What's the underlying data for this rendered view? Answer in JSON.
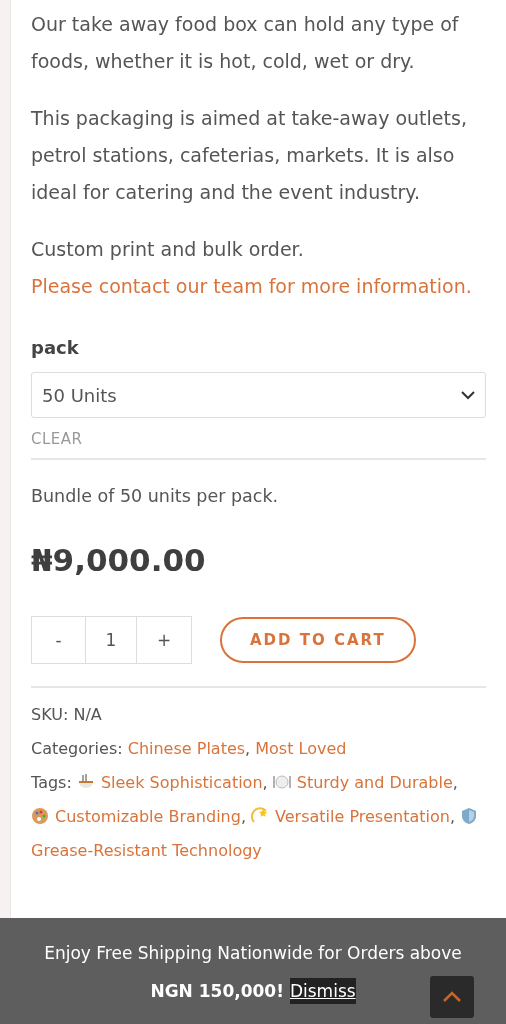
{
  "intro_paragraphs": [
    "Our take away food box can hold any type of foods, whether it is hot, cold, wet or dry.",
    "This packaging is aimed at take-away outlets, petrol stations, cafeterias, markets.  It is also ideal for catering and the event industry."
  ],
  "contact": {
    "text": "Custom print and bulk order. ",
    "link": "Please contact our team for more information."
  },
  "variation": {
    "label": "pack",
    "value": "50 Units",
    "clear": "CLEAR"
  },
  "variation_description": "Bundle of 50 units per pack.",
  "price": "₦9,000.00",
  "quantity": {
    "minus": "-",
    "value": "1",
    "plus": "+"
  },
  "add_to_cart": "ADD TO CART",
  "meta": {
    "sku": "SKU: N/A",
    "categories_label": "Categories: ",
    "categories": [
      {
        "label": "Chinese Plates",
        "separator": ", "
      },
      {
        "label": "Most Loved"
      }
    ],
    "tags_label": "Tags: ",
    "tags": [
      {
        "label": "Sleek Sophistication",
        "separator": ", "
      },
      {
        "label": "Sturdy and Durable",
        "separator": ", "
      },
      {
        "label": "Customizable Branding",
        "separator": ", "
      },
      {
        "label": "Versatile Presentation",
        "separator": ", "
      },
      {
        "label": "Grease-Resistant Technology"
      }
    ]
  },
  "notice": {
    "text": "Enjoy Free Shipping Nationwide for Orders above",
    "amount": "NGN 150,000!",
    "dismiss": "Dismiss"
  }
}
